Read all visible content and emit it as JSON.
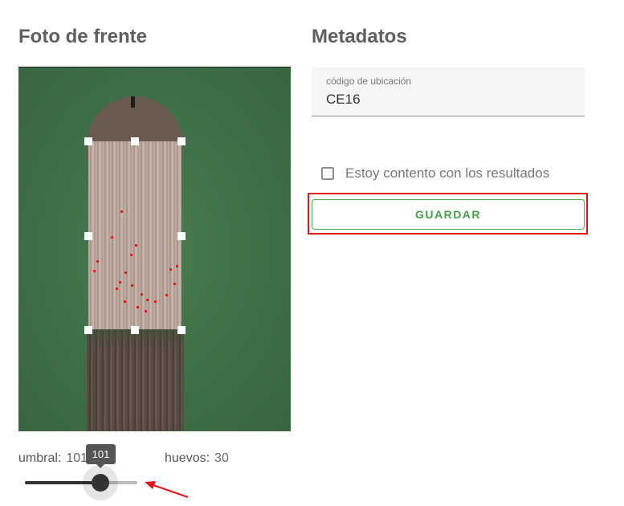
{
  "left_panel": {
    "title": "Foto de frente",
    "umbral_label": "umbral:",
    "umbral_value": "101",
    "huevos_label": "huevos:",
    "huevos_value": "30",
    "slider": {
      "value": 101,
      "tooltip": "101",
      "fraction": 0.67
    }
  },
  "right_panel": {
    "title": "Metadatos",
    "location_field": {
      "label": "código de ubicación",
      "value": "CE16"
    },
    "confirm_checkbox": {
      "label": "Estoy contento con los resultados",
      "checked": false
    },
    "save_button": "GUARDAR"
  },
  "colors": {
    "accent_green": "#43a047",
    "highlight_red": "#e0151a",
    "photo_background": "#3f7449"
  }
}
